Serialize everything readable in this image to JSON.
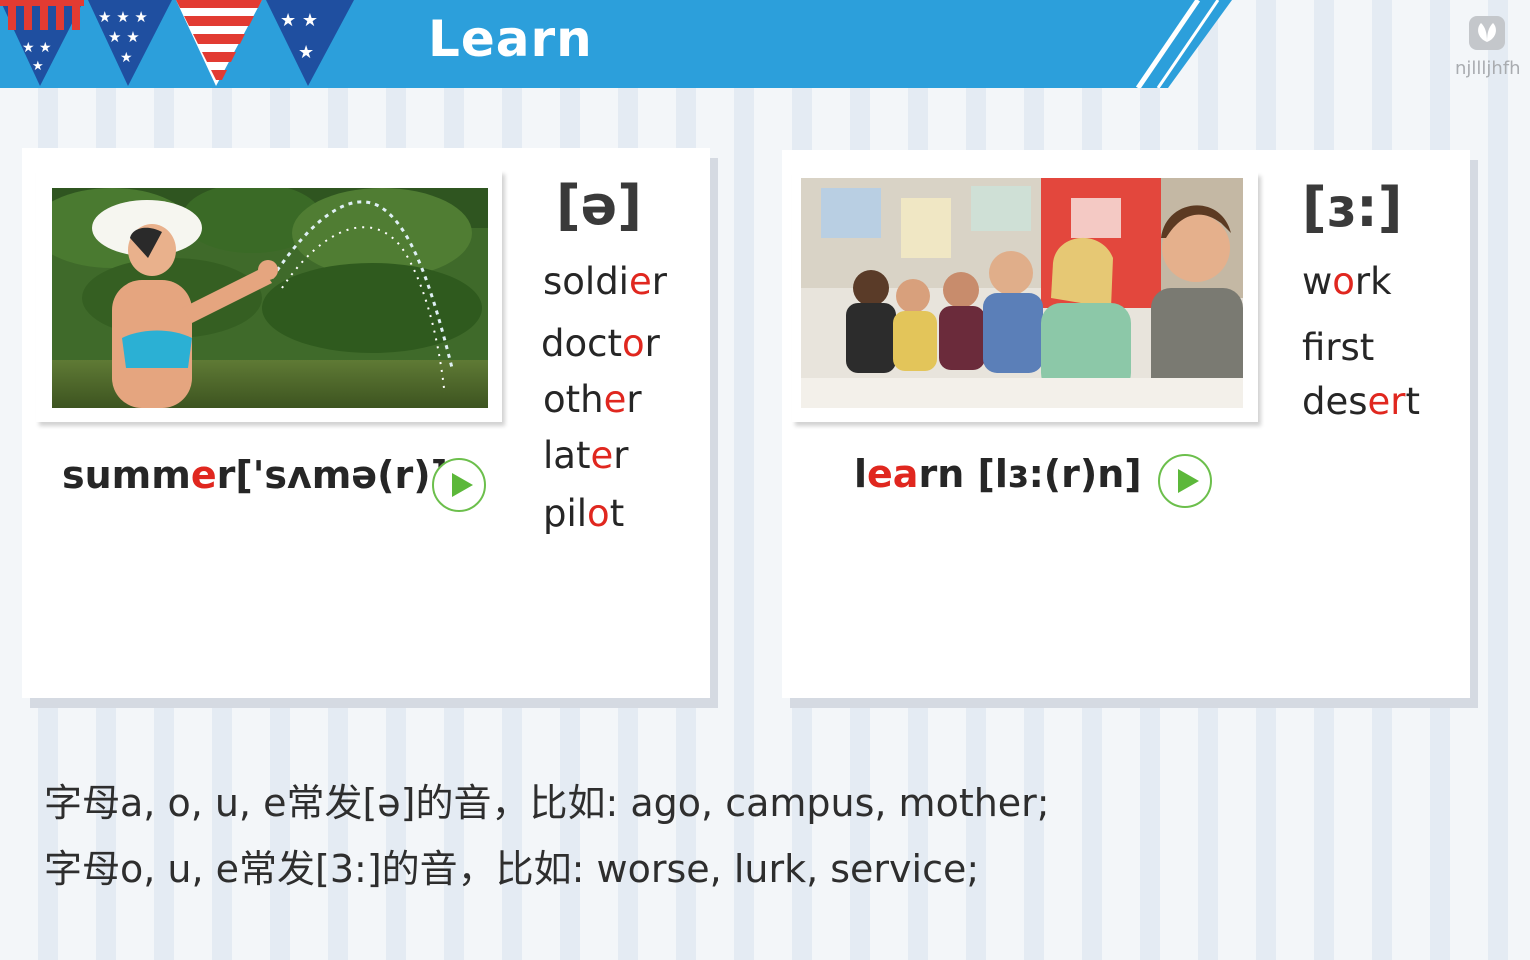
{
  "header": {
    "title": "Learn",
    "bg_color": "#2c9fdb",
    "logo_text": "njllljhfh"
  },
  "left_card": {
    "phonetic": "[ə]",
    "example": {
      "pre": "summ",
      "hl": "e",
      "post": "r",
      "ipa": "['sʌmə(r)]"
    },
    "words": [
      {
        "pre": "soldi",
        "hl": "e",
        "post": "r"
      },
      {
        "pre": "doct",
        "hl": "o",
        "post": "r"
      },
      {
        "pre": "oth",
        "hl": "e",
        "post": "r"
      },
      {
        "pre": "lat",
        "hl": "e",
        "post": "r"
      },
      {
        "pre": "pil",
        "hl": "o",
        "post": "t"
      }
    ],
    "play_icon": "play-icon"
  },
  "right_card": {
    "phonetic": "[ɜ:]",
    "example": {
      "pre": "l",
      "hl": "ea",
      "post": "rn",
      "ipa": "[lɜ:(r)n]"
    },
    "words": [
      {
        "pre": "w",
        "hl": "o",
        "post": "rk"
      },
      {
        "pre": "f",
        "hl": "i",
        "post": "rst"
      },
      {
        "pre": "des",
        "hl": "er",
        "post": "t"
      }
    ],
    "play_icon": "play-icon"
  },
  "rules": [
    "字母a, o, u, e常发[ə]的音，比如: ago, campus, mother;",
    "字母o, u, e常发[3:]的音，比如: worse, lurk, service;"
  ],
  "colors": {
    "highlight": "#e0271f",
    "play": "#5cb83a",
    "header": "#2c9fdb"
  }
}
